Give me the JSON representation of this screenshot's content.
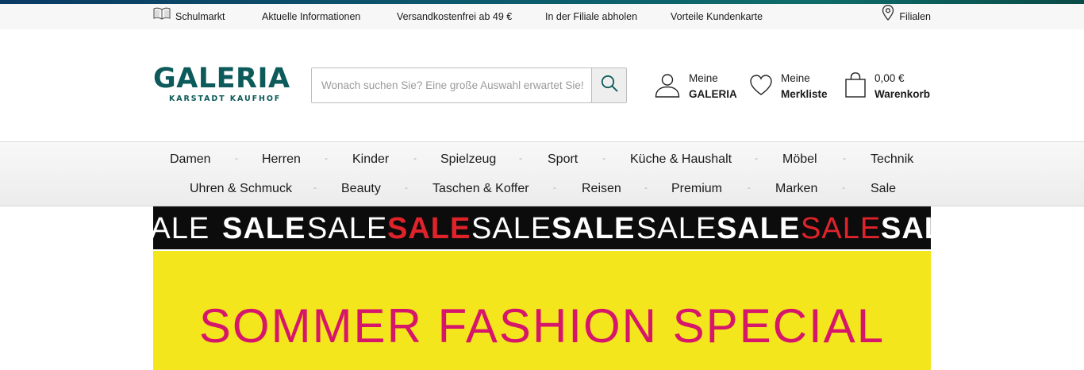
{
  "service_bar": {
    "school_market": "Schulmarkt",
    "current_info": "Aktuelle Informationen",
    "free_shipping": "Versandkostenfrei ab 49 €",
    "store_pickup": "In der Filiale abholen",
    "card_benefits": "Vorteile Kundenkarte",
    "stores": "Filialen"
  },
  "logo": {
    "main": "GALERIA",
    "sub": "KARSTADT  KAUFHOF"
  },
  "search": {
    "placeholder": "Wonach suchen Sie? Eine große Auswahl erwartet Sie!",
    "value": ""
  },
  "account": {
    "user_line1": "Meine",
    "user_line2": "GALERIA",
    "wishlist_line1": "Meine",
    "wishlist_line2": "Merkliste",
    "cart_amount": "0,00 €",
    "cart_label": "Warenkorb"
  },
  "nav": {
    "row1": [
      "Damen",
      "Herren",
      "Kinder",
      "Spielzeug",
      "Sport",
      "Küche & Haushalt",
      "Möbel",
      "Technik"
    ],
    "row2": [
      "Uhren & Schmuck",
      "Beauty",
      "Taschen & Koffer",
      "Reisen",
      "Premium",
      "Marken",
      "Sale"
    ],
    "separator": "-"
  },
  "sale_strip": {
    "words": [
      "SALE",
      "SALE",
      "SALE",
      "SALE",
      "SALE",
      "SALE",
      "SALE",
      "SALE",
      "SALE",
      "SALE"
    ],
    "colors": {
      "white": "#ffffff",
      "red": "#e0232b",
      "background": "#0c0c0c"
    }
  },
  "promo": {
    "title": "SOMMER FASHION SPECIAL",
    "background": "#f4e61c",
    "text_color": "#d6166b"
  },
  "theme": {
    "brand": "#0d5a5a",
    "icons": [
      "book-icon",
      "location-pin-icon",
      "search-icon",
      "user-icon",
      "heart-icon",
      "shopping-bag-icon"
    ]
  }
}
